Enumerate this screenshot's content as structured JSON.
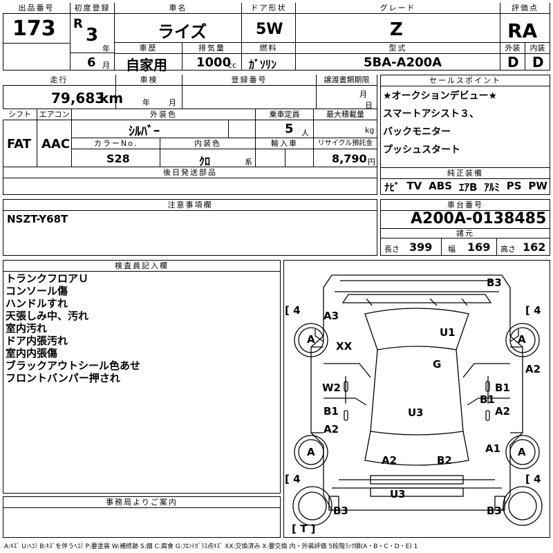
{
  "header": {
    "lot_no_label": "出品番号",
    "lot_no": "173",
    "first_reg_label": "初度登録",
    "era": "R",
    "year": "3",
    "year_unit": "年",
    "month": "6",
    "month_unit": "月",
    "car_name_label": "車名",
    "car_name": "ライズ",
    "door_label": "ドア形状",
    "door": "5W",
    "grade_label": "グレード",
    "grade": "Z",
    "score_label": "評価点",
    "score": "RA",
    "history_label": "車歴",
    "history": "自家用",
    "displacement_label": "排気量",
    "displacement": "1000",
    "displacement_unit": "cc",
    "fuel_label": "燃料",
    "fuel": "ｶﾞｿﾘﾝ",
    "model_label": "型式",
    "model": "5BA-A200A",
    "exterior_label": "外装",
    "exterior": "D",
    "interior_label": "内装",
    "interior": "D"
  },
  "row2": {
    "mileage_label": "走行",
    "mileage": "79,683",
    "mileage_unit": "km",
    "inspection_label": "車検",
    "insp_year": "年",
    "insp_month": "月",
    "reg_no_label": "登録番号",
    "transfer_label": "譲渡書類期限",
    "transfer_month": "月",
    "transfer_day": "日",
    "shift_label": "シフト",
    "shift": "FAT",
    "ac_label": "エアコン",
    "ac": "AAC",
    "color_label": "外装色",
    "color": "ｼﾙﾊﾞｰ",
    "capacity_label": "乗車定員",
    "capacity": "5",
    "capacity_unit": "人",
    "maxload_label": "最大積載量",
    "maxload_unit": "kg",
    "color_no_label": "カラーNo.",
    "color_no": "S28",
    "int_color_label": "内装色",
    "int_color": "ｸﾛ",
    "int_color_unit": "系",
    "import_label": "輸入車",
    "recycle_label": "リサイクル預託金",
    "recycle": "8,790",
    "recycle_unit": "円",
    "later_parts_label": "後日発送部品"
  },
  "sales": {
    "label": "セールスポイント",
    "lines": [
      "★オークションデビュー★",
      "スマートアシスト３、",
      "バックモニター",
      "プッシュスタート"
    ]
  },
  "equipment": {
    "label": "純正装備",
    "items": [
      "ﾅﾋﾞ",
      "TV",
      "ABS",
      "ｴｱB",
      "ｱﾙﾐ",
      "PS",
      "PW"
    ]
  },
  "caution": {
    "label": "注意事項欄",
    "text": "NSZT-Y68T"
  },
  "chassis": {
    "label": "車台番号",
    "value": "A200A-0138485",
    "spec_label": "諸元",
    "length_label": "長さ",
    "length": "399",
    "width_label": "幅",
    "width": "169",
    "height_label": "高さ",
    "height": "162"
  },
  "inspector": {
    "label": "検査員記入欄",
    "lines": [
      "トランクフロアＵ",
      "コンソール傷",
      "ハンドルすれ",
      "天張しみ中、汚れ",
      "室内汚れ",
      "ドア内張汚れ",
      "室内内張傷",
      "ブラックアウトシール色あせ",
      "フロントバンパー押され"
    ]
  },
  "office": {
    "label": "事務局よりご案内"
  },
  "diagram": {
    "tire_fl": "4",
    "tire_fr": "4",
    "tire_rl": "4",
    "tire_rr": "4",
    "spare": "T",
    "labels": [
      "B3",
      "A3",
      "XX",
      "U1",
      "G",
      "A2",
      "W2",
      "B1",
      "B1",
      "B1",
      "A2",
      "U3",
      "A2",
      "A1",
      "A2",
      "B2",
      "U3",
      "B3",
      "B3"
    ],
    "wheel_letters": [
      "A",
      "A",
      "A",
      "A"
    ]
  },
  "legend": "A:ｷｽﾞ U:ﾍｺﾐ B:ｷｽﾞを伴うﾍｺﾐ P:要塗装 W:補修跡 S:錆 C:腐食 G:ﾌﾛﾝﾄｶﾞﾗｽ点ｷｽﾞ XX:交換済み X:要交換 内・外装評価 5段階ﾗﾝｸ順(A・B・C・D・E) 1"
}
